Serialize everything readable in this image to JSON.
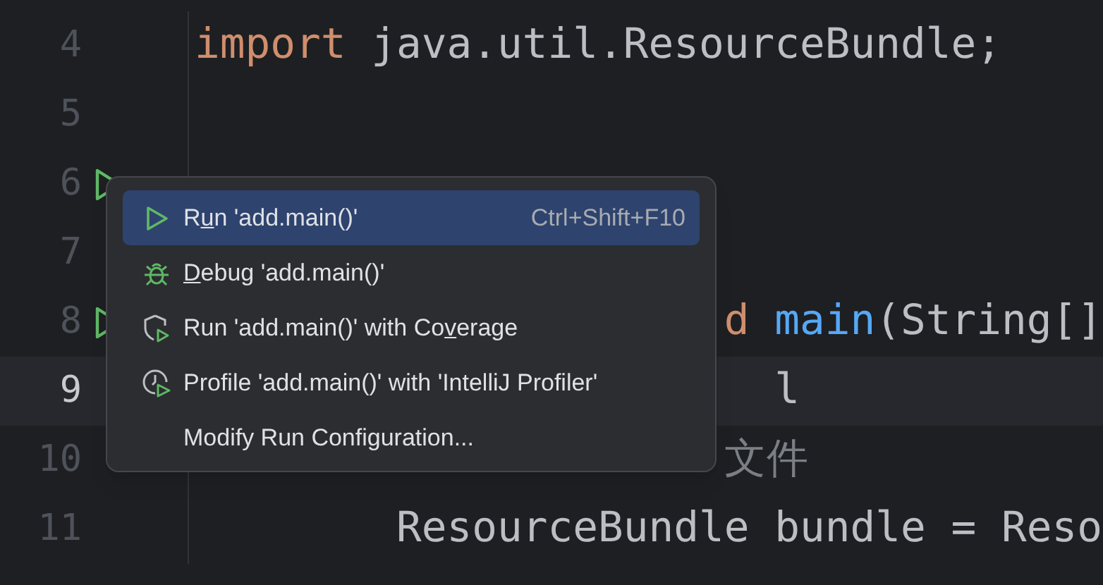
{
  "editor": {
    "lines": [
      {
        "number": "4",
        "current": false,
        "run_marker": false,
        "tokens": [
          {
            "text": "import",
            "kind": "keyword"
          },
          {
            "text": " java.util.ResourceBundle;",
            "kind": "plain"
          }
        ]
      },
      {
        "number": "5",
        "current": false,
        "run_marker": false
      },
      {
        "number": "6",
        "current": false,
        "run_marker": true
      },
      {
        "number": "7",
        "current": false,
        "run_marker": false
      },
      {
        "number": "8",
        "current": false,
        "run_marker": true,
        "tokens": [
          {
            "text": "                     d",
            "kind": "keyword"
          },
          {
            "text": " main",
            "kind": "method"
          },
          {
            "text": "(String[]",
            "kind": "plain"
          }
        ]
      },
      {
        "number": "9",
        "current": true,
        "run_marker": false,
        "tokens": [
          {
            "text": "                       l",
            "kind": "plain"
          }
        ]
      },
      {
        "number": "10",
        "current": false,
        "run_marker": false,
        "tokens": [
          {
            "text": "                     文件",
            "kind": "comment"
          }
        ]
      },
      {
        "number": "11",
        "current": false,
        "run_marker": false,
        "tokens": [
          {
            "text": "        ResourceBundle bundle = Reso",
            "kind": "plain"
          }
        ]
      }
    ]
  },
  "context_menu": {
    "items": [
      {
        "kind": "run",
        "before": "R",
        "mnemonic": "u",
        "after": "n 'add.main()'",
        "shortcut": "Ctrl+Shift+F10",
        "selected": true
      },
      {
        "kind": "debug",
        "mnemonic": "D",
        "after": "ebug 'add.main()'",
        "selected": false
      },
      {
        "kind": "coverage",
        "before": "Run 'add.main()' with Co",
        "mnemonic": "v",
        "after": "erage",
        "selected": false
      },
      {
        "kind": "profile",
        "before": "Profile 'add.main()' with 'IntelliJ Profiler'",
        "selected": false
      },
      {
        "kind": "plain",
        "before": "Modify Run Configuration...",
        "selected": false
      }
    ]
  }
}
